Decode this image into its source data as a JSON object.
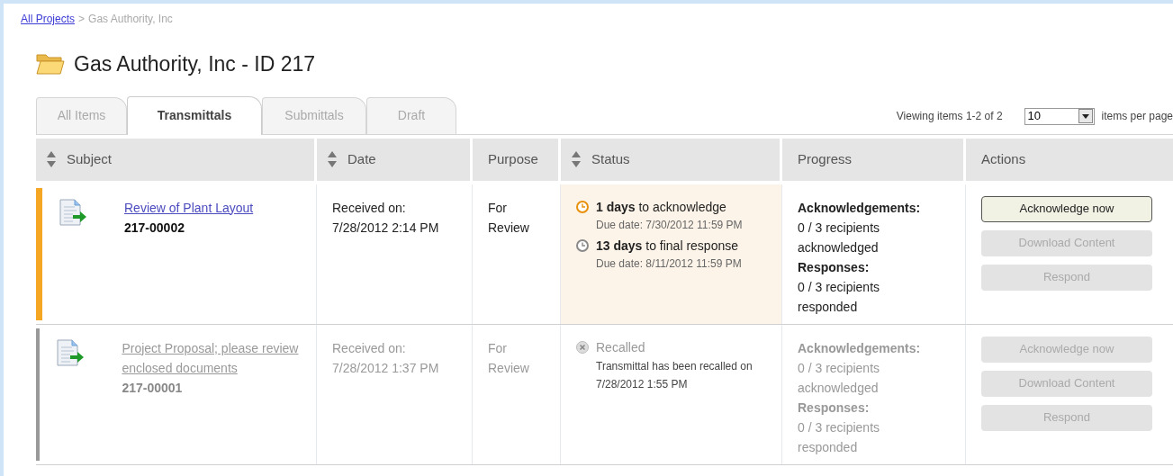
{
  "breadcrumb": {
    "link": "All Projects",
    "separator": ">",
    "current": "Gas Authority, Inc"
  },
  "title": "Gas Authority, Inc - ID 217",
  "tabs": [
    {
      "label": "All Items",
      "selected": false
    },
    {
      "label": "Transmittals",
      "selected": true
    },
    {
      "label": "Submittals",
      "selected": false
    },
    {
      "label": "Draft",
      "selected": false
    }
  ],
  "paging": {
    "viewing": "Viewing items 1-2 of 2",
    "per_page_value": "10",
    "per_page_label": "items per page"
  },
  "columns": [
    {
      "label": "Subject",
      "sortable": true
    },
    {
      "label": "Date",
      "sortable": true
    },
    {
      "label": "Purpose",
      "sortable": false
    },
    {
      "label": "Status",
      "sortable": true
    },
    {
      "label": "Progress",
      "sortable": false
    },
    {
      "label": "Actions",
      "sortable": false
    }
  ],
  "rows": [
    {
      "color": "#f5a623",
      "disabled": false,
      "subject": "Review of Plant Layout",
      "number": "217-00002",
      "date_label": "Received on:",
      "date": "7/28/2012 2:14 PM",
      "purpose": "For Review",
      "status": {
        "kind": "pending",
        "deadlines": [
          {
            "color": "#e8900c",
            "text": "**1 days** to acknowledge",
            "due": "Due date: 7/30/2012 11:59 PM"
          },
          {
            "color": "#8a8a8a",
            "text": "**13 days** to final response",
            "due": "Due date: 8/11/2012 11:59 PM"
          }
        ]
      },
      "progress": [
        {
          "label": "Acknowledgements:",
          "value": "0 / 3 recipients acknowledged"
        },
        {
          "label": "Responses:",
          "value": "0 / 3 recipients responded"
        }
      ],
      "actions": [
        {
          "label": "Acknowledge now",
          "disabled": false
        },
        {
          "label": "Download Content",
          "disabled": true
        },
        {
          "label": "Respond",
          "disabled": true
        }
      ]
    },
    {
      "color": "#999999",
      "disabled": true,
      "subject": "Project Proposal; please review enclosed documents",
      "number": "217-00001",
      "date_label": "Received on:",
      "date": "7/28/2012 1:37 PM",
      "purpose": "For Review",
      "status": {
        "kind": "recalled",
        "label": "Recalled",
        "note": "Transmittal has been recalled on 7/28/2012 1:55 PM"
      },
      "progress": [
        {
          "label": "Acknowledgements:",
          "value": "0 / 3 recipients acknowledged"
        },
        {
          "label": "Responses:",
          "value": "0 / 3 recipients responded"
        }
      ],
      "actions": [
        {
          "label": "Acknowledge now",
          "disabled": true
        },
        {
          "label": "Download Content",
          "disabled": true
        },
        {
          "label": "Respond",
          "disabled": true
        }
      ]
    }
  ]
}
